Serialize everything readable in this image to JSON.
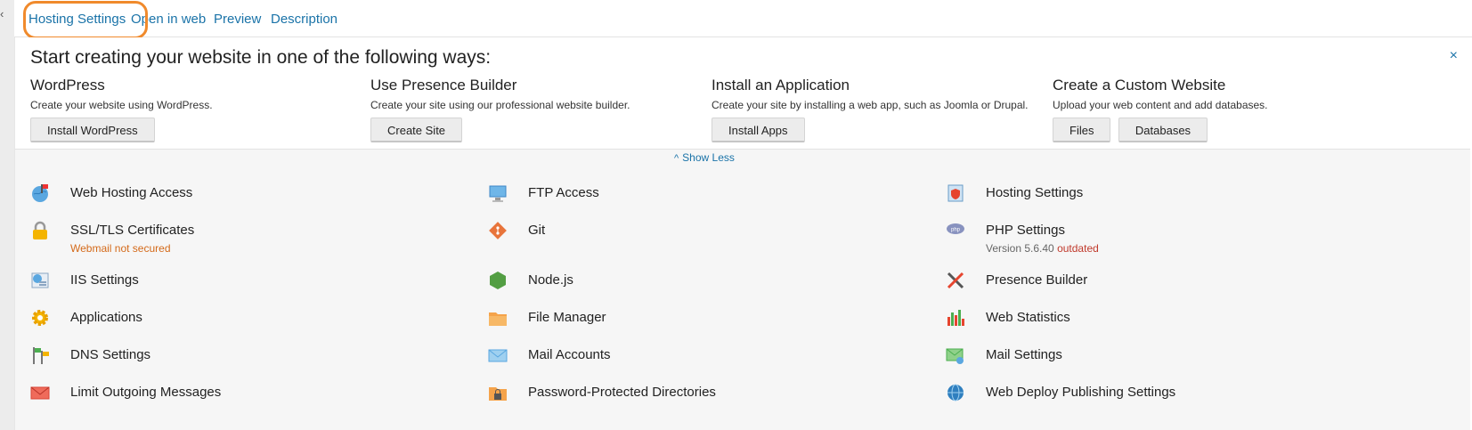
{
  "tabs": [
    "Hosting Settings",
    "Open in web",
    "Preview",
    "Description"
  ],
  "start": {
    "title": "Start creating your website in one of the following ways:",
    "close_icon": "×",
    "columns": [
      {
        "title": "WordPress",
        "desc": "Create your website using WordPress.",
        "buttons": [
          "Install WordPress"
        ]
      },
      {
        "title": "Use Presence Builder",
        "desc": "Create your site using our professional website builder.",
        "buttons": [
          "Create Site"
        ]
      },
      {
        "title": "Install an Application",
        "desc": "Create your site by installing a web app, such as Joomla or Drupal.",
        "buttons": [
          "Install Apps"
        ]
      },
      {
        "title": "Create a Custom Website",
        "desc": "Upload your web content and add databases.",
        "buttons": [
          "Files",
          "Databases"
        ]
      }
    ]
  },
  "show_less": "Show Less",
  "tools": [
    {
      "label": "Web Hosting Access",
      "icon": "globe-flag-icon"
    },
    {
      "label": "FTP Access",
      "icon": "ftp-icon"
    },
    {
      "label": "Hosting Settings",
      "icon": "hosting-settings-icon"
    },
    {
      "label": "SSL/TLS Certificates",
      "icon": "padlock-icon",
      "sub": "Webmail not secured"
    },
    {
      "label": "Git",
      "icon": "git-icon"
    },
    {
      "label": "PHP Settings",
      "icon": "php-icon",
      "sub": "Version 5.6.40",
      "sub_status": "outdated"
    },
    {
      "label": "IIS Settings",
      "icon": "iis-icon"
    },
    {
      "label": "Node.js",
      "icon": "nodejs-icon"
    },
    {
      "label": "Presence Builder",
      "icon": "tools-icon"
    },
    {
      "label": "Applications",
      "icon": "gear-icon"
    },
    {
      "label": "File Manager",
      "icon": "folder-icon"
    },
    {
      "label": "Web Statistics",
      "icon": "bar-chart-icon"
    },
    {
      "label": "DNS Settings",
      "icon": "dns-flags-icon"
    },
    {
      "label": "Mail Accounts",
      "icon": "envelope-icon"
    },
    {
      "label": "Mail Settings",
      "icon": "mail-settings-icon"
    },
    {
      "label": "Limit Outgoing Messages",
      "icon": "mail-limit-icon"
    },
    {
      "label": "Password-Protected Directories",
      "icon": "locked-folder-icon"
    },
    {
      "label": "Web Deploy Publishing Settings",
      "icon": "web-deploy-icon"
    }
  ],
  "colors": {
    "link": "#1a73a8",
    "highlight": "#f08a2c",
    "warning": "#d46a1a",
    "outdated": "#c0392b"
  }
}
